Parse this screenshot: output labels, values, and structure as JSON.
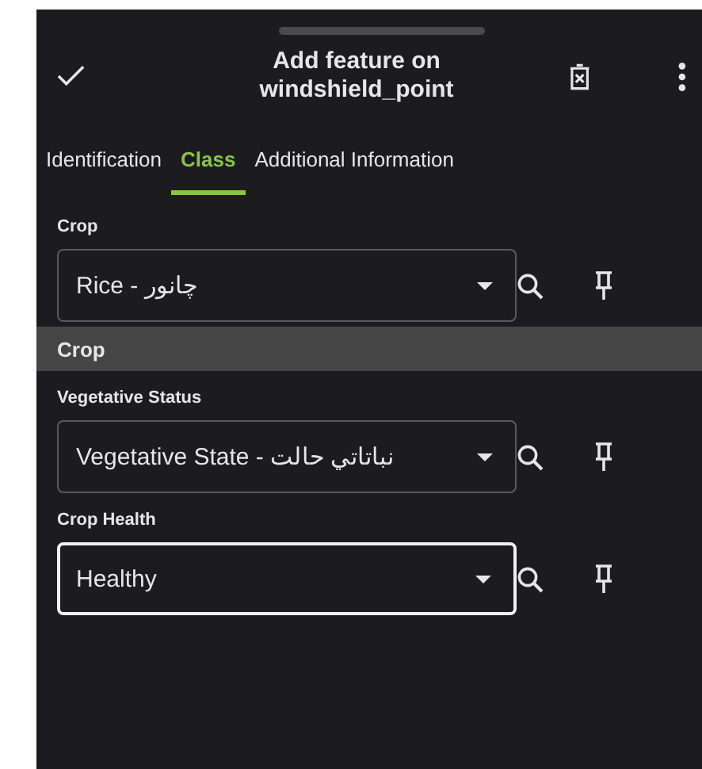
{
  "header": {
    "title_line_1": "Add feature on",
    "title_line_2": "windshield_point"
  },
  "tabs": [
    {
      "label": "Identification",
      "selected": false
    },
    {
      "label": "Class",
      "selected": true
    },
    {
      "label": "Additional Information",
      "selected": false
    }
  ],
  "sections": [
    {
      "kind": "field",
      "label": "Crop",
      "value": "Rice - چانور",
      "focused": false
    },
    {
      "kind": "group",
      "label": "Crop"
    },
    {
      "kind": "field",
      "label": "Vegetative Status",
      "value": "Vegetative State - نباتاتي حالت",
      "focused": false
    },
    {
      "kind": "field",
      "label": "Crop Health",
      "value": "Healthy",
      "focused": true
    }
  ]
}
